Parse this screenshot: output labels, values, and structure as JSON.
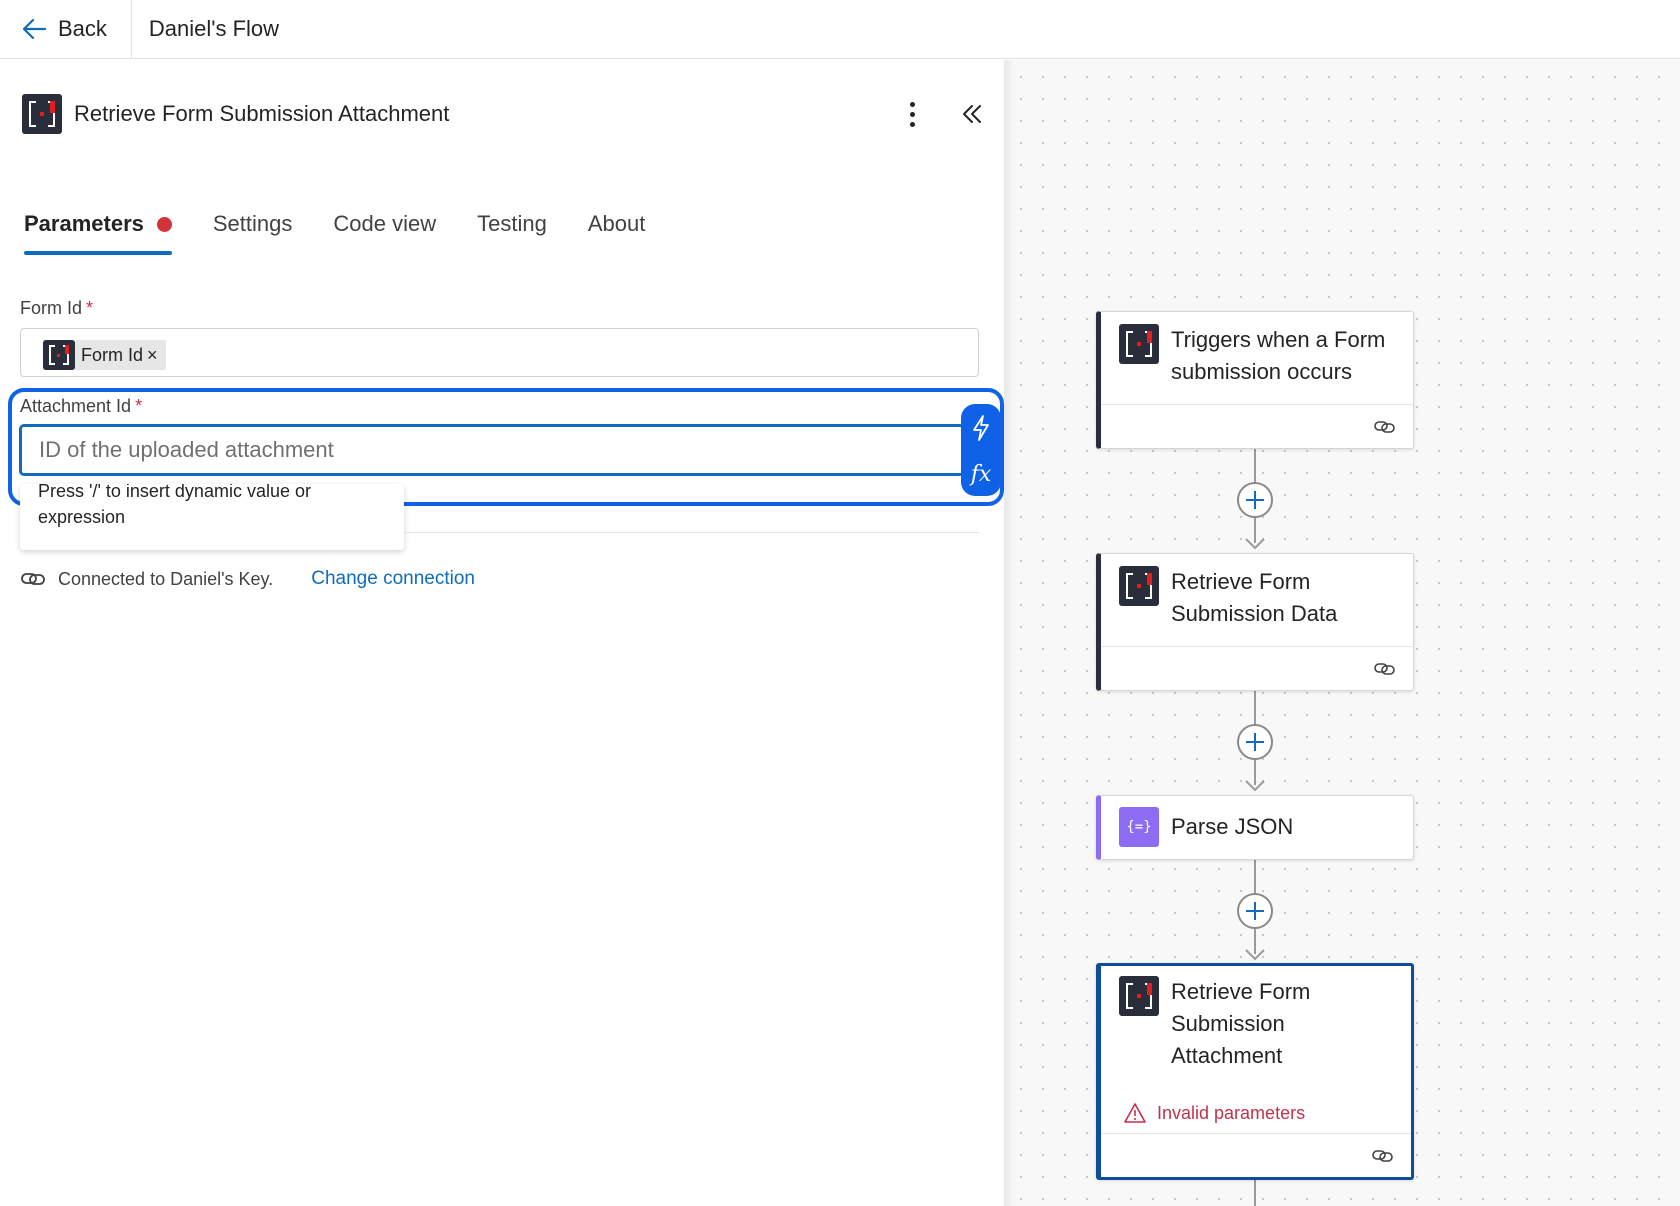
{
  "topbar": {
    "back_label": "Back",
    "flow_name": "Daniel's Flow"
  },
  "panel": {
    "title": "Retrieve Form Submission Attachment",
    "tabs": [
      {
        "label": "Parameters",
        "active": true,
        "error": true
      },
      {
        "label": "Settings"
      },
      {
        "label": "Code view"
      },
      {
        "label": "Testing"
      },
      {
        "label": "About"
      }
    ],
    "form_id": {
      "label": "Form Id",
      "required_mark": "*",
      "token_label": "Form Id",
      "token_remove": "×"
    },
    "attachment_id": {
      "label": "Attachment Id",
      "required_mark": "*",
      "placeholder": "ID of the uploaded attachment",
      "dynamic_button_icon": "lightning-icon",
      "expression_button_label": "fx"
    },
    "hint_text": "Press '/' to insert dynamic value or expression",
    "connection": {
      "text": "Connected to Daniel's Key.",
      "change_label": "Change connection"
    }
  },
  "canvas": {
    "nodes": [
      {
        "title": "Triggers when a Form submission occurs",
        "icon": "app-icon"
      },
      {
        "title": "Retrieve Form Submission Data",
        "icon": "app-icon"
      },
      {
        "title": "Parse JSON",
        "icon": "json-icon",
        "icon_glyph": "{=}"
      },
      {
        "title": "Retrieve Form Submission Attachment",
        "icon": "app-icon",
        "selected": true,
        "error": "Invalid parameters"
      }
    ]
  },
  "colors": {
    "accent": "#0f6cbd",
    "focus": "#0f62e6",
    "error": "#c4314b",
    "json": "#8b6cf3",
    "app_icon_bg": "#2a2d3a"
  }
}
